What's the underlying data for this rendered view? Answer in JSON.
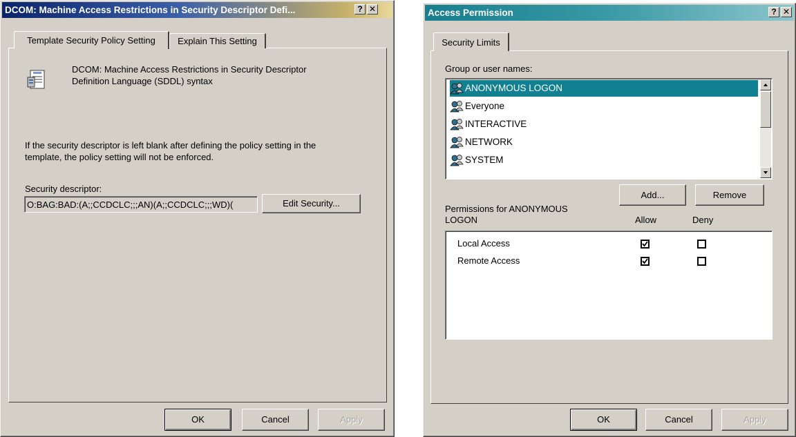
{
  "left_dialog": {
    "title": "DCOM: Machine Access Restrictions in Security Descriptor Defi...",
    "help_button": "?",
    "close_button": "✕",
    "tabs": [
      {
        "label": "Template Security Policy Setting",
        "active": true
      },
      {
        "label": "Explain This Setting",
        "active": false
      }
    ],
    "policy_heading_line1": "DCOM: Machine Access Restrictions in Security Descriptor",
    "policy_heading_line2": "Definition Language (SDDL) syntax",
    "info_line1": "If the security descriptor is left blank after defining the policy setting in the",
    "info_line2": "template, the policy setting will not be enforced.",
    "descriptor_label": "Security descriptor:",
    "descriptor_value": "O:BAG:BAD:(A;;CCDCLC;;;AN)(A;;CCDCLC;;;WD)(",
    "edit_security_button": "Edit Security...",
    "ok_button": "OK",
    "cancel_button": "Cancel",
    "apply_button": "Apply"
  },
  "right_dialog": {
    "title": "Access Permission",
    "help_button": "?",
    "close_button": "✕",
    "tab_label": "Security Limits",
    "group_label": "Group or user names:",
    "users": [
      {
        "name": "ANONYMOUS LOGON",
        "selected": true
      },
      {
        "name": "Everyone",
        "selected": false
      },
      {
        "name": "INTERACTIVE",
        "selected": false
      },
      {
        "name": "NETWORK",
        "selected": false
      },
      {
        "name": "SYSTEM",
        "selected": false
      }
    ],
    "add_button": "Add...",
    "remove_button": "Remove",
    "permissions_label_line1": "Permissions for ANONYMOUS",
    "permissions_label_line2": "LOGON",
    "allow_header": "Allow",
    "deny_header": "Deny",
    "permissions": [
      {
        "name": "Local Access",
        "allow": true,
        "deny": false
      },
      {
        "name": "Remote Access",
        "allow": true,
        "deny": false
      }
    ],
    "ok_button": "OK",
    "cancel_button": "Cancel",
    "apply_button": "Apply"
  }
}
